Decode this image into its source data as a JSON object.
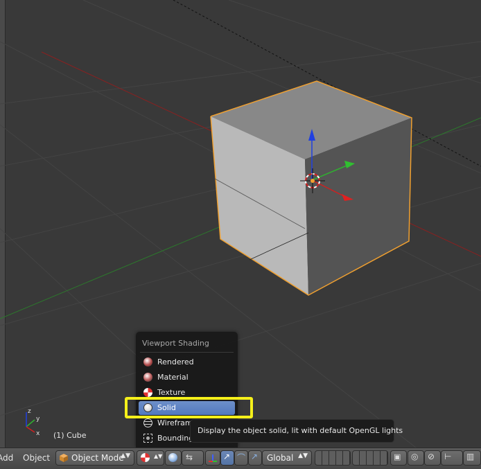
{
  "viewport": {
    "object_info": "(1) Cube"
  },
  "header": {
    "add_menu": "Add",
    "object_menu": "Object",
    "mode_select": "Object Mode",
    "orientation_select": "Global"
  },
  "shading_menu": {
    "title": "Viewport Shading",
    "items": [
      {
        "label": "Rendered",
        "icon": "rendered-shading-icon"
      },
      {
        "label": "Material",
        "icon": "material-shading-icon"
      },
      {
        "label": "Texture",
        "icon": "texture-shading-icon"
      },
      {
        "label": "Solid",
        "icon": "solid-shading-icon",
        "selected": true
      },
      {
        "label": "Wirefram",
        "icon": "wireframe-shading-icon"
      },
      {
        "label": "Bounding Box",
        "icon": "bounding-box-shading-icon"
      }
    ]
  },
  "tooltip": {
    "text": "Display the object solid, lit with default OpenGL lights"
  },
  "colors": {
    "selection_outline": "#f0a030",
    "annotation_highlight": "#f5f01a",
    "menu_selected": "#5b82c4",
    "x_axis": "#c02020",
    "y_axis": "#30a030",
    "z_axis": "#2040e0"
  }
}
